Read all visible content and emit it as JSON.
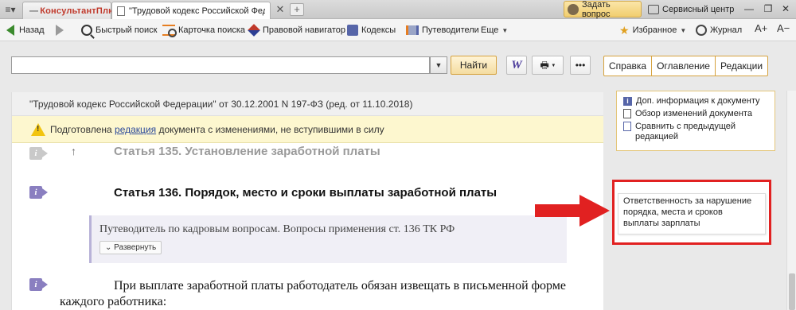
{
  "tabbar": {
    "app_name_prefix": "Консультант",
    "app_name_suffix": "Плюс",
    "active_tab_title": "\"Трудовой кодекс Российской Федера...",
    "ask_question": "Задать вопрос",
    "service_center": "Сервисный центр"
  },
  "toolbar": {
    "back": "Назад",
    "quick_search": "Быстрый поиск",
    "search_card": "Карточка поиска",
    "legal_navigator": "Правовой навигатор",
    "codes": "Кодексы",
    "guides": "Путеводители",
    "more": "Еще",
    "favorites": "Избранное",
    "journal": "Журнал",
    "font_larger": "А+",
    "font_smaller": "А−"
  },
  "search": {
    "value": "",
    "placeholder": "",
    "find_button": "Найти"
  },
  "right_tabs": [
    "Справка",
    "Оглавление",
    "Редакции"
  ],
  "document": {
    "header": "\"Трудовой кодекс Российской Федерации\" от 30.12.2001 N 197-ФЗ (ред. от 11.10.2018)",
    "warning_before": "Подготовлена ",
    "warning_link": "редакция",
    "warning_after": " документа с изменениями, не вступившими в силу",
    "article_135": "Статья 135. Установление заработной платы",
    "article_136": "Статья 136. Порядок, место и сроки выплаты заработной платы",
    "guide_text": "Путеводитель по кадровым вопросам. Вопросы применения ст. 136 ТК РФ",
    "expand_button": "Развернуть",
    "body_text": "При выплате заработной платы работодатель обязан извещать в письменной форме каждого работника:"
  },
  "side_panel": {
    "links": [
      "Доп. информация к документу",
      "Обзор изменений документа",
      "Сравнить с предыдущей редакцией"
    ],
    "highlight_note": "Ответственность за нарушение порядка, места и сроков выплаты зарплаты"
  },
  "colors": {
    "accent_orange": "#d6a23e",
    "highlight_red": "#e12121",
    "info_purple": "#8a7fc0"
  }
}
